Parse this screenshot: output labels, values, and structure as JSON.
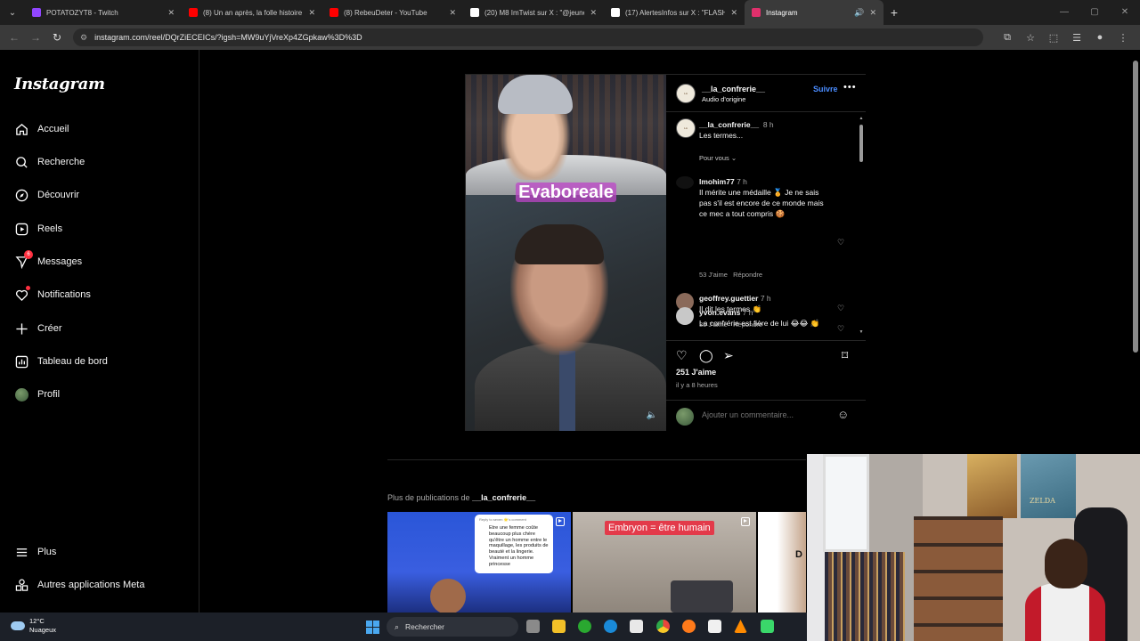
{
  "browser": {
    "tabs": [
      {
        "title": "POTATOZYT8 - Twitch",
        "favicon_color": "#9146ff",
        "active": false
      },
      {
        "title": "(8) Un an après, la folle histoire",
        "favicon_color": "#ff0000",
        "active": false
      },
      {
        "title": "(8) RebeuDeter - YouTube",
        "favicon_color": "#ff0000",
        "active": false
      },
      {
        "title": "(20) M8 ImTwist sur X : \"@jeune",
        "favicon_color": "#ffffff",
        "active": false
      },
      {
        "title": "(17) AlertesInfos sur X : \"FLASH",
        "favicon_color": "#ffffff",
        "active": false
      },
      {
        "title": "Instagram",
        "favicon_color": "#e1306c",
        "active": true
      }
    ],
    "url": "instagram.com/reel/DQrZiECEICs/?igsh=MW9uYjVreXp4ZGpkaw%3D%3D"
  },
  "sidebar": {
    "logo": "Instagram",
    "items": [
      {
        "label": "Accueil",
        "icon": "home-icon"
      },
      {
        "label": "Recherche",
        "icon": "search-icon"
      },
      {
        "label": "Découvrir",
        "icon": "compass-icon"
      },
      {
        "label": "Reels",
        "icon": "reels-icon"
      },
      {
        "label": "Messages",
        "icon": "messenger-icon",
        "badge": "6"
      },
      {
        "label": "Notifications",
        "icon": "heart-icon"
      },
      {
        "label": "Créer",
        "icon": "plus-icon"
      },
      {
        "label": "Tableau de bord",
        "icon": "dashboard-icon"
      },
      {
        "label": "Profil",
        "icon": "avatar"
      }
    ],
    "bottom": [
      {
        "label": "Plus",
        "icon": "menu-icon"
      },
      {
        "label": "Autres applications Meta",
        "icon": "meta-apps-icon"
      }
    ]
  },
  "post": {
    "video_overlay": "Evaboreale",
    "author": "__la_confrerie__",
    "audio": "Audio d'origine",
    "follow": "Suivre",
    "caption": {
      "user": "__la_confrerie__",
      "time": "8 h",
      "text": "Les termes..."
    },
    "sort": "Pour vous",
    "comments": [
      {
        "user": "lmohim77",
        "time": "7 h",
        "text": "Il mérite une médaille 🏅 Je ne sais pas s'il est encore de ce monde mais ce mec a tout compris 🍪",
        "likes": "53 J'aime",
        "reply": "Répondre"
      },
      {
        "user": "geoffrey.guettier",
        "time": "7 h",
        "text": "Il dit les termes 👏",
        "likes": "35 J'aime",
        "reply": "Répondre"
      },
      {
        "user": "yvon.evans",
        "time": "7 h",
        "text": "La confrérie est fière de lui 😂😂 👏"
      }
    ],
    "likes": "251 J'aime",
    "posted": "il y a 8 heures",
    "add_comment_placeholder": "Ajouter un commentaire..."
  },
  "more": {
    "prefix": "Plus de publications de",
    "user": "__la_confrerie__",
    "thumb1_reply": "Reply to seven 🌟's comment",
    "thumb1_text": "Etre une femme coûte beaucoup plus chère qu'être un homme entre le maquillage, les produits de beauté et la lingerie. Vraiment un homme princesse",
    "thumb2_label": "Embryon = être humain",
    "thumb3_label": "D"
  },
  "cam": {
    "poster_text": "ZELDA"
  },
  "taskbar": {
    "temp": "12°C",
    "weather": "Nuageux",
    "search": "Rechercher",
    "icons": [
      {
        "name": "task-view-icon",
        "color": "#8a8a8a"
      },
      {
        "name": "file-explorer-icon",
        "color": "#f2c028"
      },
      {
        "name": "xbox-icon",
        "color": "#2aa830"
      },
      {
        "name": "edge-icon",
        "color": "#1a8ad8"
      },
      {
        "name": "store-icon",
        "color": "#e8e8e8"
      },
      {
        "name": "chrome-icon",
        "color": "#e8453c"
      },
      {
        "name": "firefox-icon",
        "color": "#ff7a1a"
      },
      {
        "name": "capcut-icon",
        "color": "#f0f0f0"
      },
      {
        "name": "vlc-icon",
        "color": "#ff8a00"
      },
      {
        "name": "android-icon",
        "color": "#3ad86a"
      }
    ]
  }
}
